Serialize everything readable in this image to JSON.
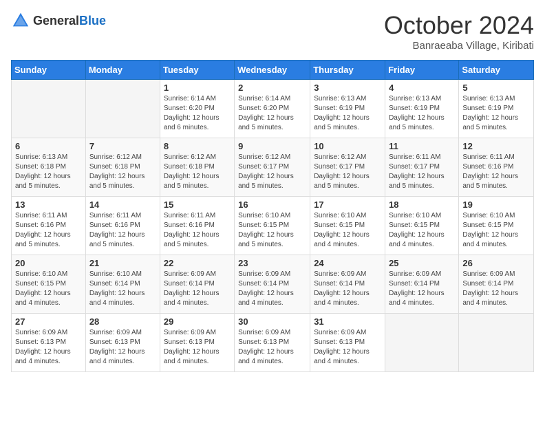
{
  "logo": {
    "general": "General",
    "blue": "Blue"
  },
  "header": {
    "month": "October 2024",
    "location": "Banraeaba Village, Kiribati"
  },
  "weekdays": [
    "Sunday",
    "Monday",
    "Tuesday",
    "Wednesday",
    "Thursday",
    "Friday",
    "Saturday"
  ],
  "weeks": [
    [
      {
        "day": "",
        "info": ""
      },
      {
        "day": "",
        "info": ""
      },
      {
        "day": "1",
        "info": "Sunrise: 6:14 AM\nSunset: 6:20 PM\nDaylight: 12 hours and 6 minutes."
      },
      {
        "day": "2",
        "info": "Sunrise: 6:14 AM\nSunset: 6:20 PM\nDaylight: 12 hours and 5 minutes."
      },
      {
        "day": "3",
        "info": "Sunrise: 6:13 AM\nSunset: 6:19 PM\nDaylight: 12 hours and 5 minutes."
      },
      {
        "day": "4",
        "info": "Sunrise: 6:13 AM\nSunset: 6:19 PM\nDaylight: 12 hours and 5 minutes."
      },
      {
        "day": "5",
        "info": "Sunrise: 6:13 AM\nSunset: 6:19 PM\nDaylight: 12 hours and 5 minutes."
      }
    ],
    [
      {
        "day": "6",
        "info": "Sunrise: 6:13 AM\nSunset: 6:18 PM\nDaylight: 12 hours and 5 minutes."
      },
      {
        "day": "7",
        "info": "Sunrise: 6:12 AM\nSunset: 6:18 PM\nDaylight: 12 hours and 5 minutes."
      },
      {
        "day": "8",
        "info": "Sunrise: 6:12 AM\nSunset: 6:18 PM\nDaylight: 12 hours and 5 minutes."
      },
      {
        "day": "9",
        "info": "Sunrise: 6:12 AM\nSunset: 6:17 PM\nDaylight: 12 hours and 5 minutes."
      },
      {
        "day": "10",
        "info": "Sunrise: 6:12 AM\nSunset: 6:17 PM\nDaylight: 12 hours and 5 minutes."
      },
      {
        "day": "11",
        "info": "Sunrise: 6:11 AM\nSunset: 6:17 PM\nDaylight: 12 hours and 5 minutes."
      },
      {
        "day": "12",
        "info": "Sunrise: 6:11 AM\nSunset: 6:16 PM\nDaylight: 12 hours and 5 minutes."
      }
    ],
    [
      {
        "day": "13",
        "info": "Sunrise: 6:11 AM\nSunset: 6:16 PM\nDaylight: 12 hours and 5 minutes."
      },
      {
        "day": "14",
        "info": "Sunrise: 6:11 AM\nSunset: 6:16 PM\nDaylight: 12 hours and 5 minutes."
      },
      {
        "day": "15",
        "info": "Sunrise: 6:11 AM\nSunset: 6:16 PM\nDaylight: 12 hours and 5 minutes."
      },
      {
        "day": "16",
        "info": "Sunrise: 6:10 AM\nSunset: 6:15 PM\nDaylight: 12 hours and 5 minutes."
      },
      {
        "day": "17",
        "info": "Sunrise: 6:10 AM\nSunset: 6:15 PM\nDaylight: 12 hours and 4 minutes."
      },
      {
        "day": "18",
        "info": "Sunrise: 6:10 AM\nSunset: 6:15 PM\nDaylight: 12 hours and 4 minutes."
      },
      {
        "day": "19",
        "info": "Sunrise: 6:10 AM\nSunset: 6:15 PM\nDaylight: 12 hours and 4 minutes."
      }
    ],
    [
      {
        "day": "20",
        "info": "Sunrise: 6:10 AM\nSunset: 6:15 PM\nDaylight: 12 hours and 4 minutes."
      },
      {
        "day": "21",
        "info": "Sunrise: 6:10 AM\nSunset: 6:14 PM\nDaylight: 12 hours and 4 minutes."
      },
      {
        "day": "22",
        "info": "Sunrise: 6:09 AM\nSunset: 6:14 PM\nDaylight: 12 hours and 4 minutes."
      },
      {
        "day": "23",
        "info": "Sunrise: 6:09 AM\nSunset: 6:14 PM\nDaylight: 12 hours and 4 minutes."
      },
      {
        "day": "24",
        "info": "Sunrise: 6:09 AM\nSunset: 6:14 PM\nDaylight: 12 hours and 4 minutes."
      },
      {
        "day": "25",
        "info": "Sunrise: 6:09 AM\nSunset: 6:14 PM\nDaylight: 12 hours and 4 minutes."
      },
      {
        "day": "26",
        "info": "Sunrise: 6:09 AM\nSunset: 6:14 PM\nDaylight: 12 hours and 4 minutes."
      }
    ],
    [
      {
        "day": "27",
        "info": "Sunrise: 6:09 AM\nSunset: 6:13 PM\nDaylight: 12 hours and 4 minutes."
      },
      {
        "day": "28",
        "info": "Sunrise: 6:09 AM\nSunset: 6:13 PM\nDaylight: 12 hours and 4 minutes."
      },
      {
        "day": "29",
        "info": "Sunrise: 6:09 AM\nSunset: 6:13 PM\nDaylight: 12 hours and 4 minutes."
      },
      {
        "day": "30",
        "info": "Sunrise: 6:09 AM\nSunset: 6:13 PM\nDaylight: 12 hours and 4 minutes."
      },
      {
        "day": "31",
        "info": "Sunrise: 6:09 AM\nSunset: 6:13 PM\nDaylight: 12 hours and 4 minutes."
      },
      {
        "day": "",
        "info": ""
      },
      {
        "day": "",
        "info": ""
      }
    ]
  ]
}
